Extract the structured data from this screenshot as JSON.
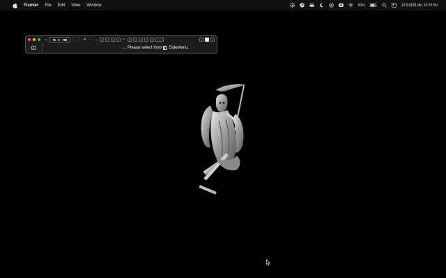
{
  "menubar": {
    "app_name": "Flanker",
    "menus": [
      "File",
      "Edit",
      "View",
      "Window"
    ],
    "battery_percent": "81%",
    "datetime": "12月26日(木) 10:37:50",
    "status_icons": [
      "gear-icon",
      "steam-icon",
      "card-icon",
      "moon-icon",
      "focus-icon",
      "screen-record-icon",
      "wifi-icon",
      "battery-icon",
      "search-icon",
      "control-center-icon"
    ]
  },
  "window": {
    "width_value": "76",
    "times": "X",
    "height_value": "768",
    "hint_arrow": "←",
    "hint_prefix": "Please select from",
    "hint_suffix": "SideMenu."
  },
  "figure": {
    "subject": "grim-reaper-statue"
  }
}
